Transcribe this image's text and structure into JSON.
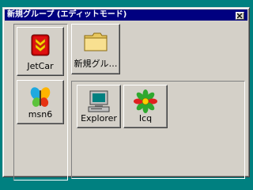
{
  "window": {
    "title": "新規グループ (エディットモード)"
  },
  "left_panel": {
    "items": [
      {
        "label": "JetCar",
        "icon": "jetcar-icon"
      },
      {
        "label": "msn6",
        "icon": "msn-butterfly-icon"
      }
    ]
  },
  "right_panel": {
    "top_items": [
      {
        "label": "新規グル…",
        "icon": "folder-icon"
      }
    ],
    "items": [
      {
        "label": "Explorer",
        "icon": "computer-icon"
      },
      {
        "label": "Icq",
        "icon": "icq-flower-icon"
      }
    ]
  },
  "colors": {
    "desktop": "#008080",
    "titlebar": "#000080",
    "face": "#d4d0c8"
  }
}
